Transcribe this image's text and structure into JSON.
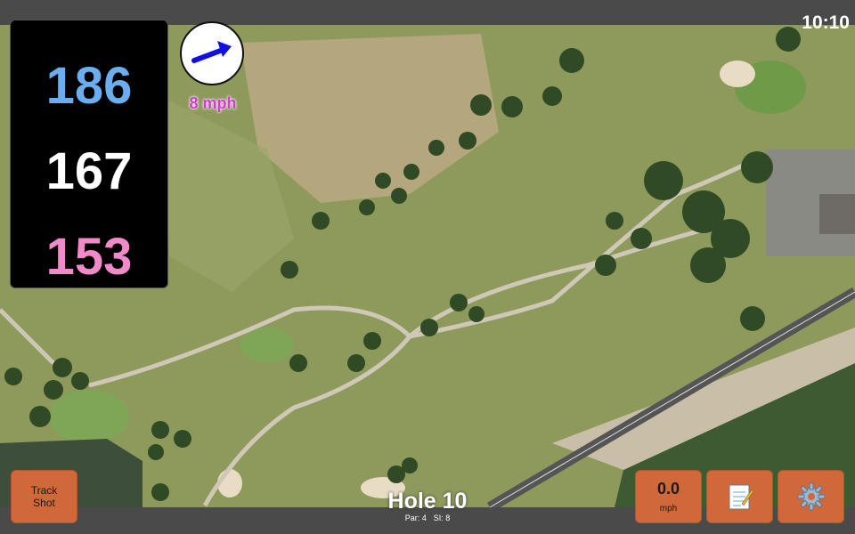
{
  "status": {
    "time": "10:10"
  },
  "yardages": {
    "back": "186",
    "middle": "167",
    "front": "153"
  },
  "wind": {
    "speed_label": "8 mph",
    "direction_icon": "arrow-icon",
    "value": "0.0",
    "unit": "mph"
  },
  "hole": {
    "title": "Hole 10",
    "par": "Par: 4",
    "stroke_index": "SI: 8"
  },
  "buttons": {
    "track_line1": "Track",
    "track_line2": "Shot",
    "notes_icon": "notepad-icon",
    "settings_icon": "gear-icon"
  },
  "colors": {
    "back_yardage": "#6aaef0",
    "middle_yardage": "#ffffff",
    "front_yardage": "#f08ac8",
    "wind_speed_text": "#d43bd0",
    "button_bg": "#d1683a",
    "wind_arrow": "#1010e0"
  }
}
